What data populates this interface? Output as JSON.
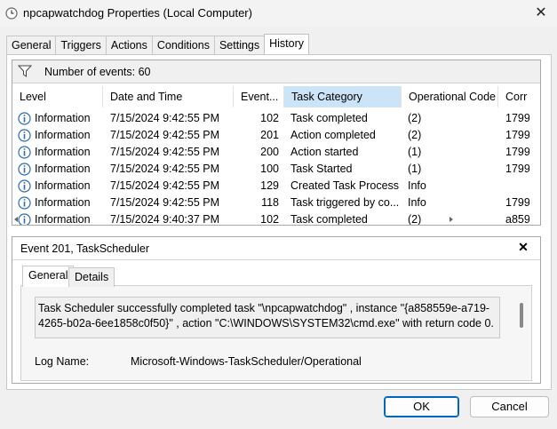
{
  "window": {
    "title": "npcapwatchdog Properties (Local Computer)",
    "close_icon": "✕"
  },
  "tabs": [
    {
      "label": "General"
    },
    {
      "label": "Triggers"
    },
    {
      "label": "Actions"
    },
    {
      "label": "Conditions"
    },
    {
      "label": "Settings"
    },
    {
      "label": "History",
      "active": true
    }
  ],
  "history": {
    "count_label": "Number of events: 60",
    "columns": [
      "Level",
      "Date and Time",
      "Event...",
      "Task Category",
      "Operational Code",
      "Corr"
    ],
    "sorted_column": "Task Category",
    "rows": [
      {
        "level": "Information",
        "date": "7/15/2024 9:42:55 PM",
        "event": "102",
        "category": "Task completed",
        "opcode": "(2)",
        "corr": "1799"
      },
      {
        "level": "Information",
        "date": "7/15/2024 9:42:55 PM",
        "event": "201",
        "category": "Action completed",
        "opcode": "(2)",
        "corr": "1799"
      },
      {
        "level": "Information",
        "date": "7/15/2024 9:42:55 PM",
        "event": "200",
        "category": "Action started",
        "opcode": "(1)",
        "corr": "1799"
      },
      {
        "level": "Information",
        "date": "7/15/2024 9:42:55 PM",
        "event": "100",
        "category": "Task Started",
        "opcode": "(1)",
        "corr": "1799"
      },
      {
        "level": "Information",
        "date": "7/15/2024 9:42:55 PM",
        "event": "129",
        "category": "Created Task Process",
        "opcode": "Info",
        "corr": ""
      },
      {
        "level": "Information",
        "date": "7/15/2024 9:42:55 PM",
        "event": "118",
        "category": "Task triggered by co...",
        "opcode": "Info",
        "corr": "1799"
      },
      {
        "level": "Information",
        "date": "7/15/2024 9:40:37 PM",
        "event": "102",
        "category": "Task completed",
        "opcode": "(2)",
        "corr": "a859"
      }
    ]
  },
  "detail": {
    "title": "Event 201, TaskScheduler",
    "close_icon": "✕",
    "subtabs": [
      {
        "label": "General",
        "active": true
      },
      {
        "label": "Details"
      }
    ],
    "message": "Task Scheduler successfully completed task \"\\npcapwatchdog\" , instance \"{a858559e-a719-4265-b02a-6ee1858c0f50}\" , action \"C:\\WINDOWS\\SYSTEM32\\cmd.exe\" with return code 0.",
    "log_name_label": "Log Name:",
    "log_name_value": "Microsoft-Windows-TaskScheduler/Operational"
  },
  "buttons": {
    "ok": "OK",
    "cancel": "Cancel"
  },
  "colors": {
    "accent": "#0067c0",
    "sorted_header": "#cce4f7",
    "info_icon": "#2b6cb0"
  }
}
